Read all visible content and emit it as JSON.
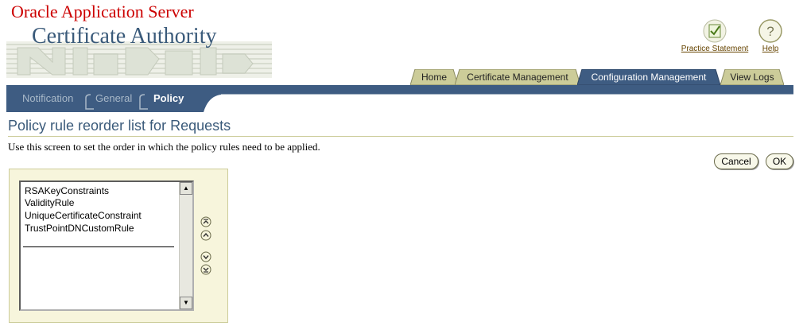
{
  "brand": {
    "product": "Oracle Application Server",
    "app": "Certificate Authority"
  },
  "global_links": [
    {
      "label": "Practice Statement",
      "icon": "practice-statement-icon"
    },
    {
      "label": "Help",
      "icon": "help-icon"
    }
  ],
  "tabs": [
    {
      "label": "Home",
      "active": false
    },
    {
      "label": "Certificate Management",
      "active": false
    },
    {
      "label": "Configuration Management",
      "active": true
    },
    {
      "label": "View Logs",
      "active": false
    }
  ],
  "subtabs": [
    {
      "label": "Notification",
      "active": false
    },
    {
      "label": "General",
      "active": false
    },
    {
      "label": "Policy",
      "active": true
    }
  ],
  "page": {
    "title": "Policy rule reorder list for Requests",
    "instruction": "Use this screen to set the order in which the policy rules need to be applied."
  },
  "buttons": {
    "cancel": "Cancel",
    "ok": "OK"
  },
  "reorder_list": {
    "items": [
      "RSAKeyConstraints",
      "ValidityRule",
      "UniqueCertificateConstraint",
      "TrustPointDNCustomRule"
    ]
  },
  "move_buttons": [
    "move-to-top-icon",
    "move-up-icon",
    "move-down-icon",
    "move-to-bottom-icon"
  ],
  "colors": {
    "brand_red": "#cc0000",
    "title_blue": "#3a5a7a",
    "nav_blue": "#3e5c82",
    "tab_tan": "#cccc99",
    "panel_bg": "#f7f5dc"
  }
}
